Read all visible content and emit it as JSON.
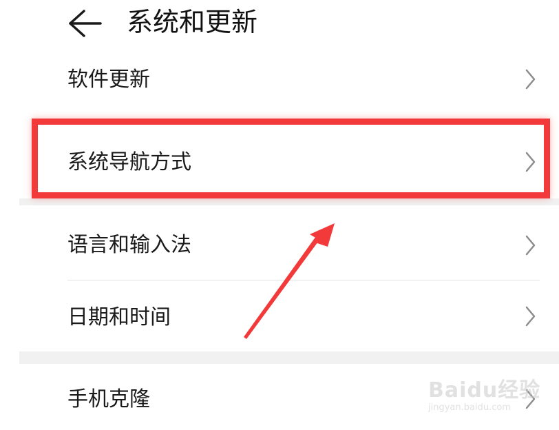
{
  "header": {
    "back_icon": "arrow-left-icon",
    "title": "系统和更新"
  },
  "settings": {
    "items": [
      {
        "label": "软件更新",
        "icon": "chevron-right-icon"
      },
      {
        "label": "系统导航方式",
        "icon": "chevron-right-icon",
        "highlighted": true
      },
      {
        "label": "语言和输入法",
        "icon": "chevron-right-icon"
      },
      {
        "label": "日期和时间",
        "icon": "chevron-right-icon"
      },
      {
        "label": "手机克隆",
        "icon": "chevron-right-icon"
      }
    ]
  },
  "annotation": {
    "highlight_color": "#f23a3a",
    "arrow_color": "#f23a3a"
  },
  "watermark": {
    "logo_text": "Baidu经验",
    "url": "jingyan.baidu.com"
  }
}
